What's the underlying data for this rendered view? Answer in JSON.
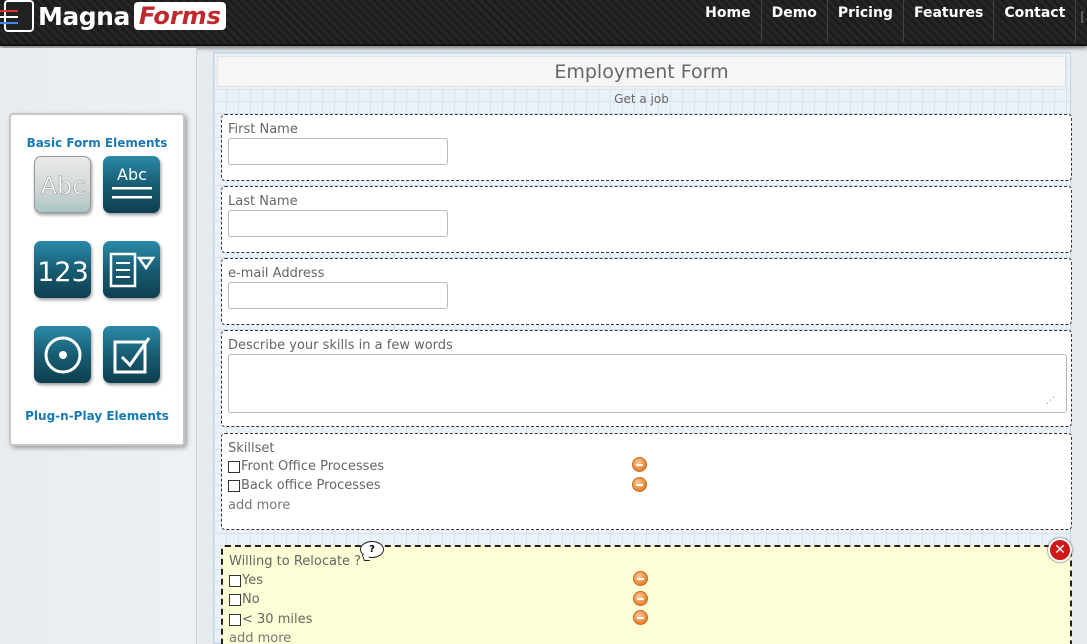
{
  "brand": {
    "name": "Magna",
    "suffix": "Forms"
  },
  "nav": [
    {
      "label": "Home"
    },
    {
      "label": "Demo"
    },
    {
      "label": "Pricing"
    },
    {
      "label": "Features"
    },
    {
      "label": "Contact"
    }
  ],
  "nav_edge": "[",
  "toolbox": {
    "basic_title": "Basic Form Elements",
    "plug_title": "Plug-n-Play Elements",
    "tiles": [
      {
        "icon": "text-input-icon",
        "text": "Abc"
      },
      {
        "icon": "text-area-icon",
        "text": "Abc"
      },
      {
        "icon": "number-input-icon",
        "text": "123"
      },
      {
        "icon": "dropdown-icon",
        "text": ""
      },
      {
        "icon": "radio-button-icon",
        "text": ""
      },
      {
        "icon": "checkbox-icon",
        "text": ""
      }
    ]
  },
  "form": {
    "title": "Employment Form",
    "subtitle": "Get a job",
    "fields": {
      "first_name": {
        "label": "First Name",
        "value": ""
      },
      "last_name": {
        "label": "Last Name",
        "value": ""
      },
      "email": {
        "label": "e-mail Address",
        "value": ""
      },
      "skills": {
        "label": "Describe your skills in a few words",
        "value": ""
      },
      "skillset": {
        "label": "Skillset",
        "options": [
          "Front Office Processes",
          "Back office Processes"
        ],
        "add_more": "add more"
      },
      "relocate": {
        "label": "Willing to Relocate ?",
        "help": "?",
        "options": [
          "Yes",
          "No",
          "< 30 miles"
        ],
        "add_more": "add more"
      }
    }
  },
  "colors": {
    "accent": "#1a7ab5",
    "selected_bg": "#fdfdd6",
    "remove": "#e8822e",
    "close": "#cc1a1a"
  }
}
